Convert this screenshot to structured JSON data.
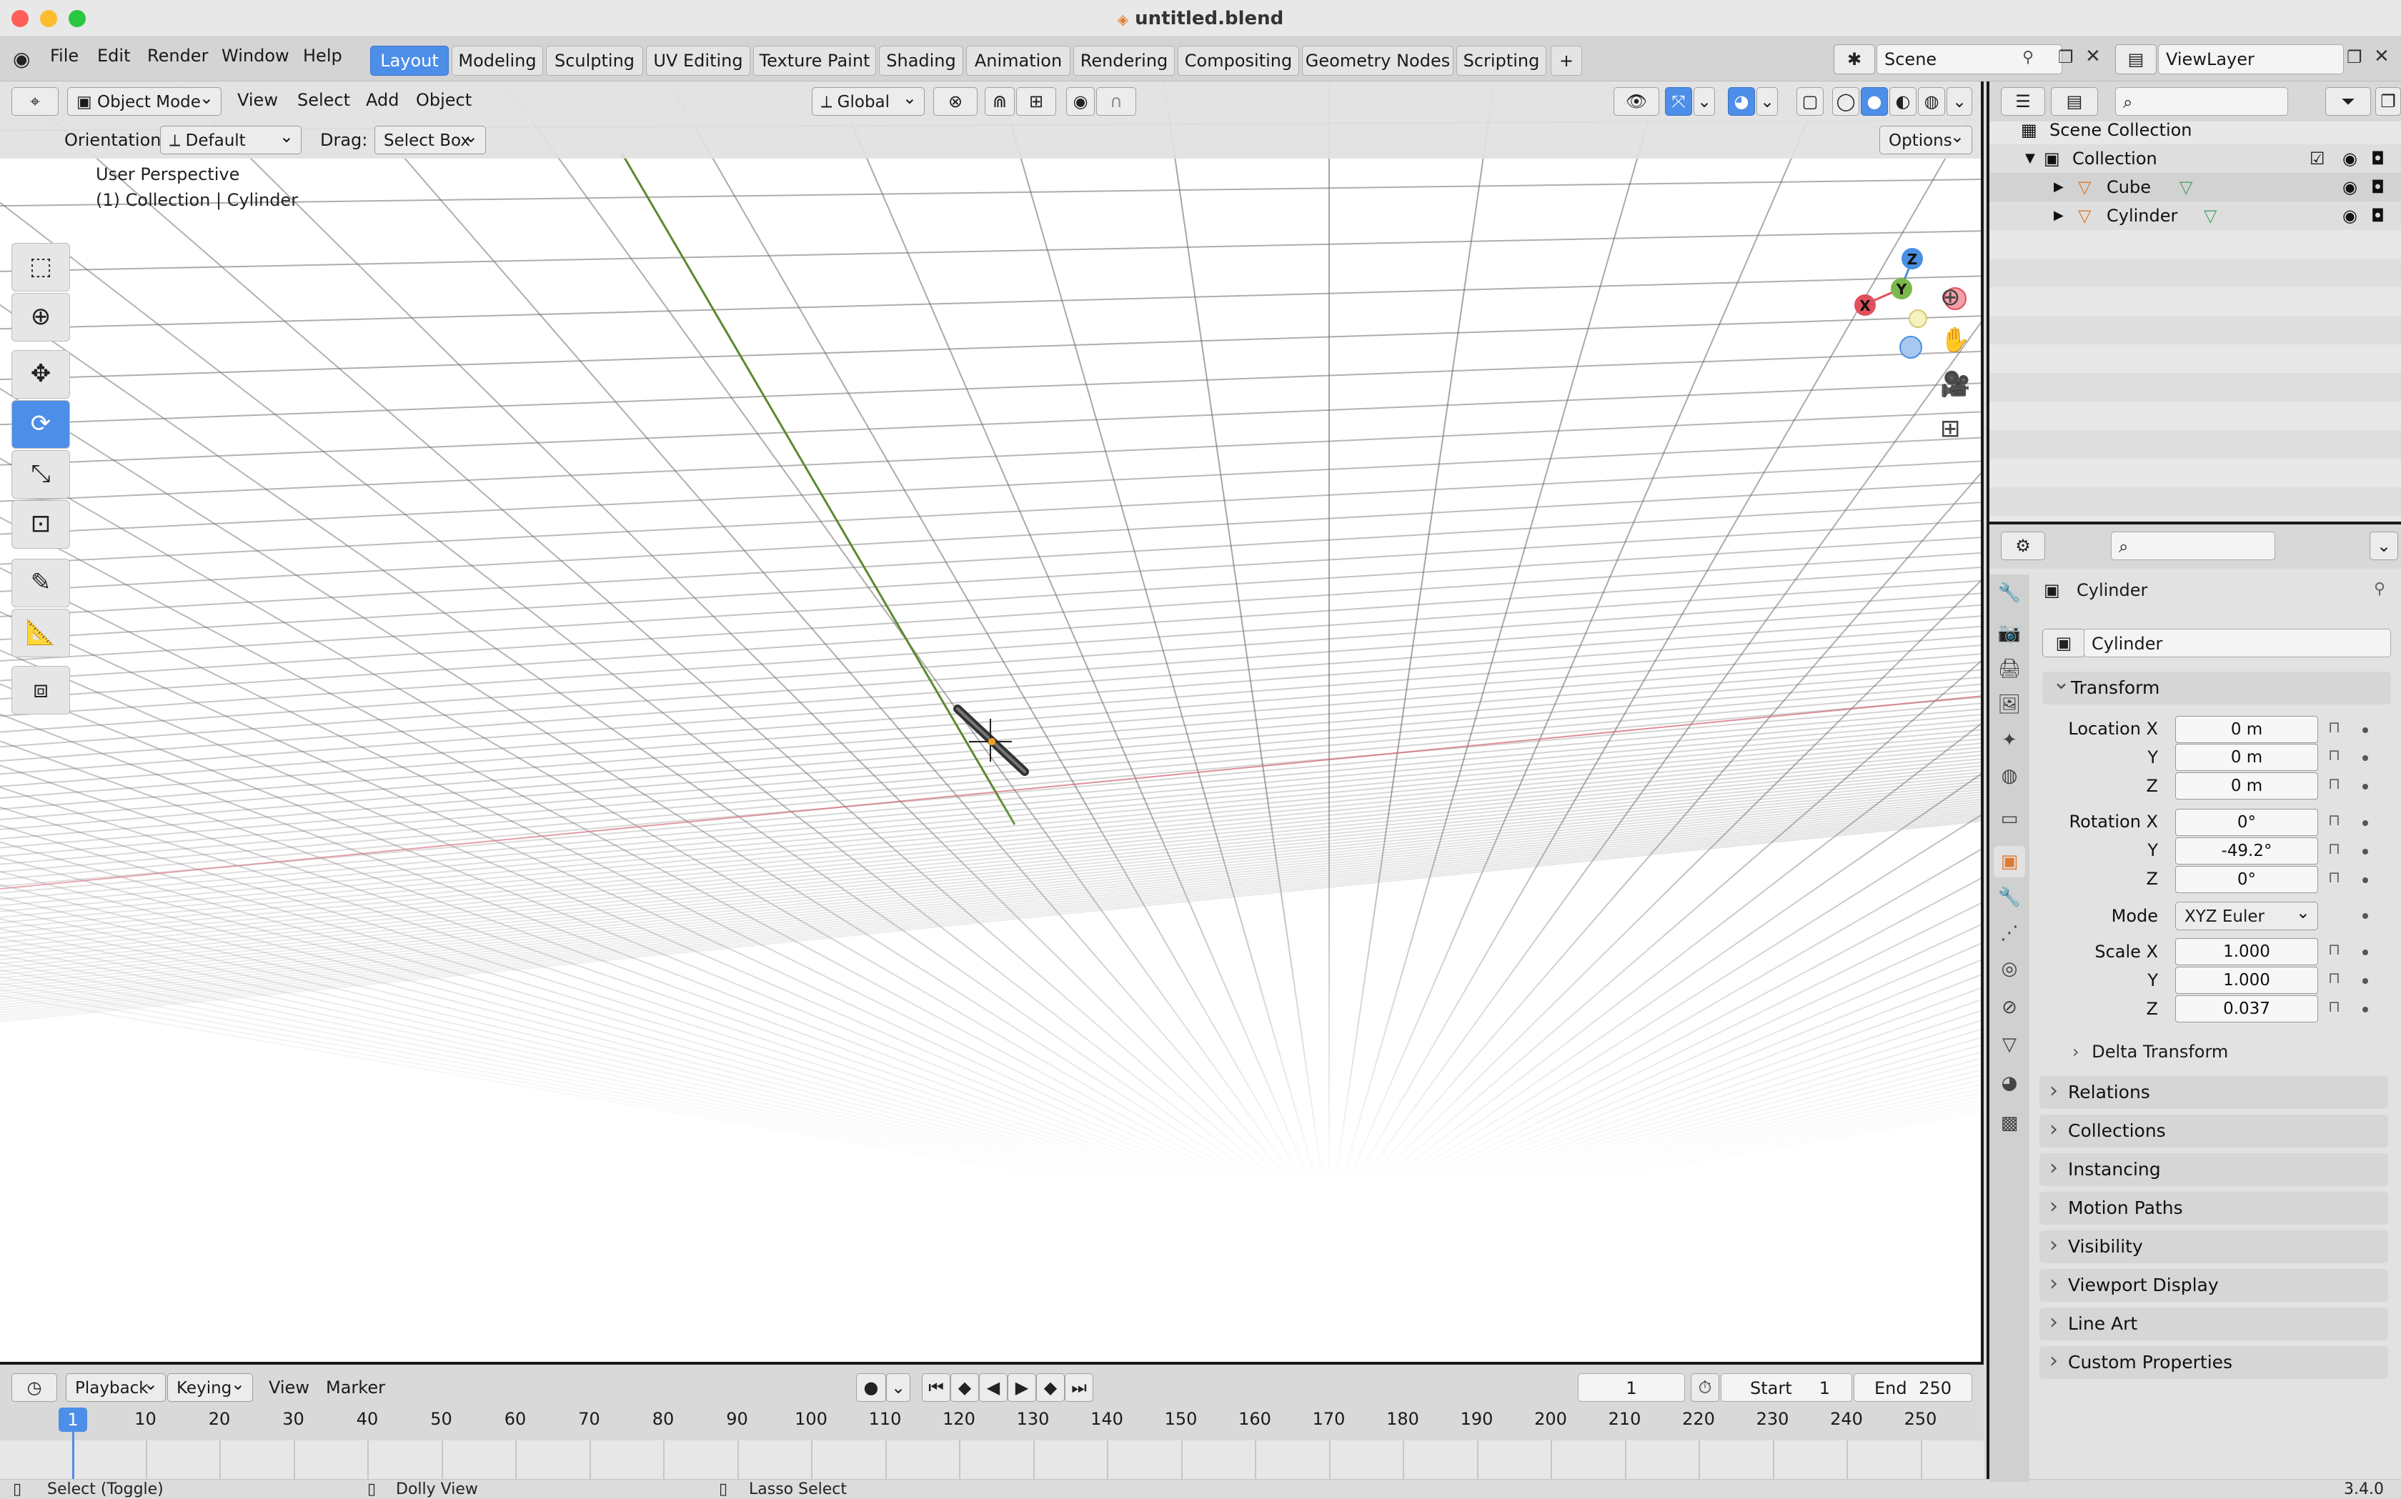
{
  "window": {
    "title": "untitled.blend",
    "file_icon": "blend-file-icon"
  },
  "menus": [
    "File",
    "Edit",
    "Render",
    "Window",
    "Help"
  ],
  "workspaces": [
    "Layout",
    "Modeling",
    "Sculpting",
    "UV Editing",
    "Texture Paint",
    "Shading",
    "Animation",
    "Rendering",
    "Compositing",
    "Geometry Nodes",
    "Scripting"
  ],
  "active_workspace": "Layout",
  "scene": {
    "name": "Scene",
    "view_layer": "ViewLayer"
  },
  "viewport": {
    "mode": "Object Mode",
    "menus": [
      "View",
      "Select",
      "Add",
      "Object"
    ],
    "transform_space": "Global",
    "orientation_label": "Orientation:",
    "orientation_value": "Default",
    "drag_label": "Drag:",
    "drag_value": "Select Box",
    "options_label": "Options",
    "overlay_line1": "User Perspective",
    "overlay_line2": "(1) Collection | Cylinder",
    "gizmo_axes": {
      "x": "X",
      "y": "Y",
      "z": "Z"
    },
    "colors": {
      "x_axis": "#e0505a",
      "y_axis": "#7ab84a",
      "z_axis": "#4a8ee0",
      "x_line": "#d06070",
      "y_line": "#5a8a30"
    }
  },
  "timeline": {
    "menus": [
      "Playback",
      "Keying",
      "View",
      "Marker"
    ],
    "current_frame": "1",
    "start_label": "Start",
    "start": "1",
    "end_label": "End",
    "end": "250",
    "ticks": [
      "10",
      "20",
      "30",
      "40",
      "50",
      "60",
      "70",
      "80",
      "90",
      "100",
      "110",
      "120",
      "130",
      "140",
      "150",
      "160",
      "170",
      "180",
      "190",
      "200",
      "210",
      "220",
      "230",
      "240",
      "250"
    ]
  },
  "statusbar": {
    "left": "Select (Toggle)",
    "middle": "Dolly View",
    "right_action": "Lasso Select",
    "version": "3.4.0"
  },
  "outliner": {
    "root": "Scene Collection",
    "collection": "Collection",
    "objects": [
      "Cube",
      "Cylinder"
    ]
  },
  "properties": {
    "object_name": "Cylinder",
    "datablock_name": "Cylinder",
    "transform_label": "Transform",
    "location": {
      "label": "Location X",
      "x": "0 m",
      "y": "0 m",
      "z": "0 m"
    },
    "rotation": {
      "label": "Rotation X",
      "x": "0°",
      "y": "-49.2°",
      "z": "0°"
    },
    "mode_label": "Mode",
    "mode_value": "XYZ Euler",
    "scale": {
      "label": "Scale X",
      "x": "1.000",
      "y": "1.000",
      "z": "0.037"
    },
    "axis_y": "Y",
    "axis_z": "Z",
    "delta": "Delta Transform",
    "panels": [
      "Relations",
      "Collections",
      "Instancing",
      "Motion Paths",
      "Visibility",
      "Viewport Display",
      "Line Art",
      "Custom Properties"
    ]
  },
  "accent": "#4d8ee8"
}
